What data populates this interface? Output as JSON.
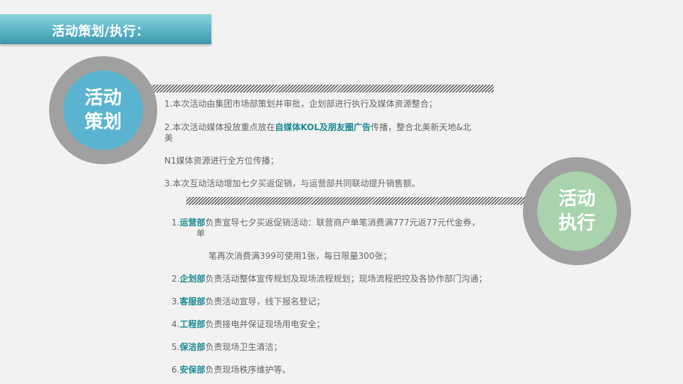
{
  "header": {
    "title": "活动策划/执行："
  },
  "planning": {
    "circle_line1": "活动",
    "circle_line2": "策划",
    "p1": "1.本次活动由集团市场部策划并审批，企划部进行执行及媒体资源整合；",
    "p2_prefix": "2.本次活动媒体投放重点放在",
    "p2_highlight": "自媒体KOL及朋友圈广告",
    "p2_suffix": "传播，整合北美新天地&北",
    "p2_wrap": "美",
    "p3": "N1媒体资源进行全方位传播；",
    "p4": "3.本次互动活动增加七夕买返促销，与运营部共同联动提升销售额。"
  },
  "execution": {
    "circle_line1": "活动",
    "circle_line2": "执行",
    "items": [
      {
        "num": "1.",
        "dept": "运营部",
        "text": "负责宣导七夕买返促销活动：联营商户单笔消费满777元返77元代金券，",
        "wrap": "单"
      },
      {
        "cont": "笔再次消费满399可使用1张，每日限量300张；"
      },
      {
        "num": "2.",
        "dept": "企划部",
        "text": "负责活动整体宣传规划及现场流程规划；现场流程把控及各协作部门沟通；"
      },
      {
        "num": "3.",
        "dept": "客服部",
        "text": "负责活动宣导，线下报名登记；"
      },
      {
        "num": "4.",
        "dept": "工程部",
        "text": "负责接电并保证现场用电安全；"
      },
      {
        "num": "5.",
        "dept": "保洁部",
        "text": "负责现场卫生清洁；"
      },
      {
        "num": "6.",
        "dept": "安保部",
        "text": "负责现场秩序维护等。"
      }
    ]
  },
  "colors": {
    "title_bar": "#5bb4c6",
    "planning_circle": "#5bb4cf",
    "execution_circle": "#a8d3ad",
    "ring": "#a0a0a0",
    "highlight": "#1b8a93",
    "body_text": "#666666"
  }
}
